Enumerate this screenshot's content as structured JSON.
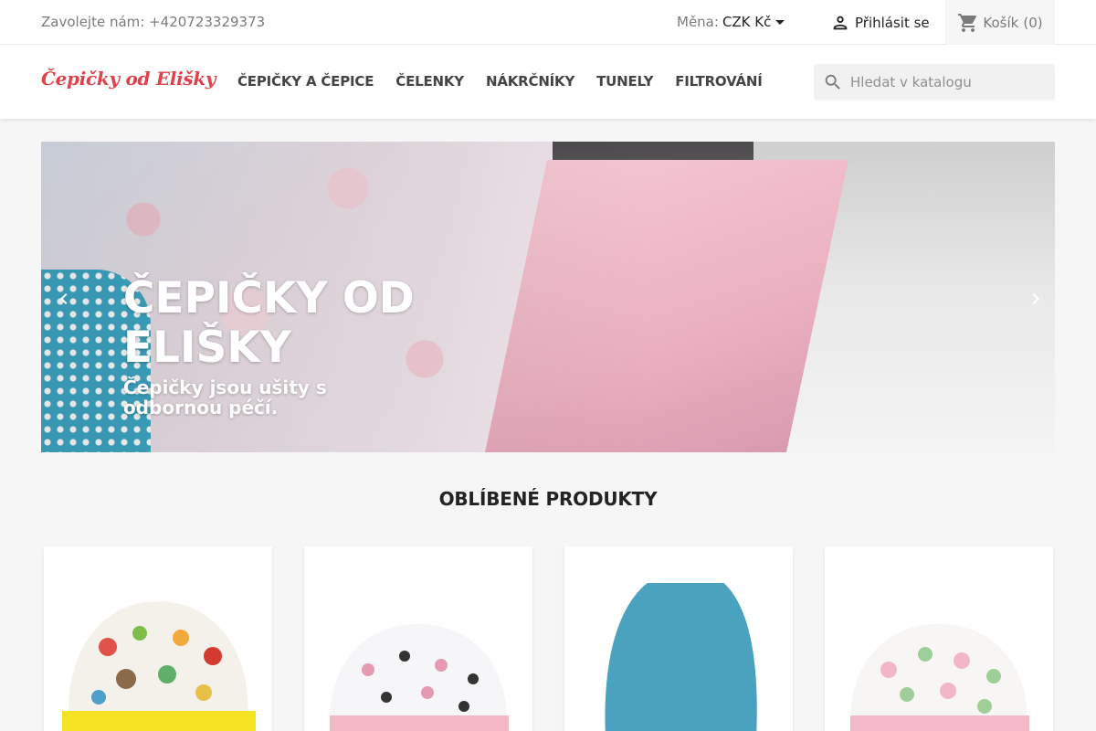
{
  "topbar": {
    "contact": "Zavolejte nám: +420723329373",
    "currency_label": "Měna:",
    "currency_value": "CZK Kč",
    "signin_label": "Přihlásit se",
    "cart_label": "Košík",
    "cart_count": "(0)"
  },
  "header": {
    "logo": "Čepičky od Elišky",
    "nav": [
      "ČEPIČKY A ČEPICE",
      "ČELENKY",
      "NÁKRČNÍKY",
      "TUNELY",
      "FILTROVÁNÍ"
    ],
    "search_placeholder": "Hledat v katalogu"
  },
  "hero": {
    "title": "ČEPIČKY OD ELIŠKY",
    "subtitle": "Čepičky jsou ušity s odbornou péčí."
  },
  "section": {
    "title": "OBLÍBENÉ PRODUKTY"
  },
  "products": [
    {
      "image": "hat-animals-yellow",
      "brim_color": "#f5e223",
      "body_color": "#f4f1ea"
    },
    {
      "image": "hat-princess-pink",
      "brim_color": "#f3b7c6",
      "body_color": "#f6f6f8"
    },
    {
      "image": "hat-plain-teal",
      "brim_color": "#3f97b3",
      "body_color": "#4aa2be"
    },
    {
      "image": "hat-snails-pink",
      "brim_color": "#f3b9c8",
      "body_color": "#f7f6f4"
    }
  ],
  "colors": {
    "logo": "#e0414a",
    "text": "#232323",
    "muted": "#7a7a7a"
  }
}
